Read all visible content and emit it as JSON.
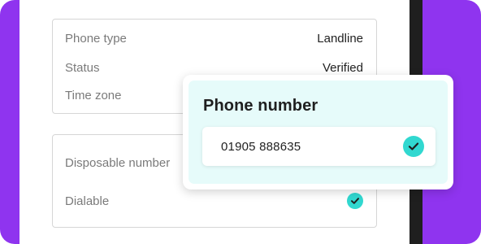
{
  "details_card": {
    "rows": [
      {
        "label": "Phone type",
        "value": "Landline"
      },
      {
        "label": "Status",
        "value": "Verified"
      },
      {
        "label": "Time zone",
        "value": ""
      }
    ]
  },
  "capabilities_card": {
    "rows": [
      {
        "label": "Disposable number"
      },
      {
        "label": "Dialable",
        "icon": "check-icon"
      }
    ]
  },
  "popup": {
    "title": "Phone number",
    "number": "01905 888635",
    "icon": "check-icon"
  },
  "colors": {
    "frame_purple": "#8F34EF",
    "dark_band": "#1F1F1F",
    "popup_background": "#E6FBFA",
    "check_accent": "#31D8D0"
  }
}
